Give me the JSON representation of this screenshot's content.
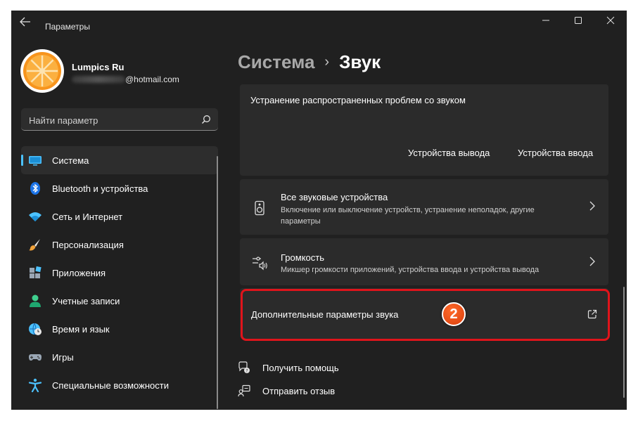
{
  "window": {
    "title": "Параметры",
    "controls": [
      "minimize-icon",
      "maximize-icon",
      "close-icon"
    ]
  },
  "profile": {
    "name": "Lumpics Ru",
    "email_domain": "@hotmail.com"
  },
  "search": {
    "placeholder": "Найти параметр"
  },
  "sidebar": {
    "items": [
      {
        "label": "Система",
        "icon": "monitor-icon",
        "active": true
      },
      {
        "label": "Bluetooth и устройства",
        "icon": "bluetooth-icon"
      },
      {
        "label": "Сеть и Интернет",
        "icon": "wifi-icon"
      },
      {
        "label": "Персонализация",
        "icon": "brush-icon"
      },
      {
        "label": "Приложения",
        "icon": "apps-icon"
      },
      {
        "label": "Учетные записи",
        "icon": "account-icon"
      },
      {
        "label": "Время и язык",
        "icon": "globe-clock-icon"
      },
      {
        "label": "Игры",
        "icon": "gamepad-icon"
      },
      {
        "label": "Специальные возможности",
        "icon": "accessibility-icon"
      }
    ]
  },
  "breadcrumb": {
    "parent": "Система",
    "separator": "›",
    "current": "Звук"
  },
  "troubleshoot": {
    "title": "Устранение распространенных проблем со звуком",
    "output_button": "Устройства вывода",
    "input_button": "Устройства ввода"
  },
  "rows": {
    "all_devices": {
      "title": "Все звуковые устройства",
      "desc_line1": "Включение или выключение устройств, устранение неполадок, другие",
      "desc_line2": "параметры",
      "icon": "speaker-icon"
    },
    "volume_mixer": {
      "title": "Громкость",
      "desc": "Микшер громкости приложений, устройства ввода и устройства вывода",
      "icon": "volume-mixer-icon"
    },
    "advanced": {
      "title": "Дополнительные параметры звука",
      "icon": "external-link-icon"
    }
  },
  "annotation": {
    "step": "2",
    "color": "#e0141b"
  },
  "footer": {
    "help": "Получить помощь",
    "feedback": "Отправить отзыв"
  },
  "colors": {
    "accent": "#4cc2ff",
    "background": "#202020",
    "card": "#2b2b2b"
  }
}
